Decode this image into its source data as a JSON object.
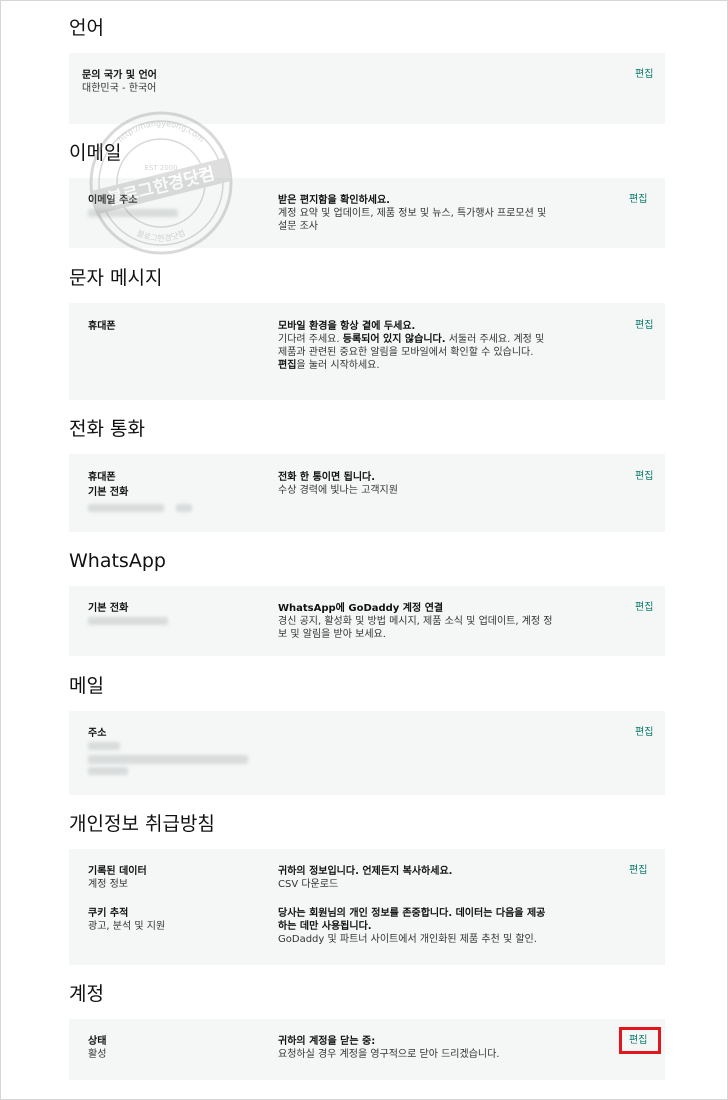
{
  "sections": {
    "language": {
      "title": "언어",
      "label": "문의 국가 및 언어",
      "value": "대한민국 - 한국어",
      "edit": "편집"
    },
    "email": {
      "title": "이메일",
      "label": "이메일 주소",
      "desc_bold": "받은 편지함을 확인하세요.",
      "desc": "계정 요약 및 업데이트, 제품 정보 및 뉴스, 특가행사 프로모션 및 설문 조사",
      "edit": "편집"
    },
    "sms": {
      "title": "문자 메시지",
      "label": "휴대폰",
      "desc_bold": "모바일 환경을 항상 곁에 두세요.",
      "desc_1": "기다려 주세요.",
      "desc_1_bold": "등록되어 있지 않습니다.",
      "desc_2": "서둘러 주세요. 계정 및 제품과 관련된 중요한 알림을 모바일에서 확인할 수 있습니다.",
      "desc_3_bold": "편집",
      "desc_3": "을 눌러 시작하세요.",
      "edit": "편집"
    },
    "phone": {
      "title": "전화 통화",
      "label_1": "휴대폰",
      "label_2": "기본 전화",
      "desc_bold": "전화 한 통이면 됩니다.",
      "desc": "수상 경력에 빛나는 고객지원",
      "edit": "편집"
    },
    "whatsapp": {
      "title": "WhatsApp",
      "label": "기본 전화",
      "desc_bold": "WhatsApp에 GoDaddy 계정 연결",
      "desc": "경신 공지, 활성화 및 방법 메시지, 제품 소식 및 업데이트, 계정 정보 및 알림을 받아 보세요.",
      "edit": "편집"
    },
    "mail": {
      "title": "메일",
      "label": "주소",
      "edit": "편집"
    },
    "privacy": {
      "title": "개인정보 취급방침",
      "row1_label": "기록된 데이터",
      "row1_value": "계정 정보",
      "row1_desc_bold": "귀하의 정보입니다. 언제든지 복사하세요.",
      "row1_desc": "CSV 다운로드",
      "row2_label": "쿠키 추적",
      "row2_value": "광고, 분석 및 지원",
      "row2_desc_bold": "당사는 회원님의 개인 정보를 존중합니다. 데이터는 다음을 제공하는 데만 사용됩니다.",
      "row2_desc": "GoDaddy 및 파트너 사이트에서 개인화된 제품 추천 및 할인.",
      "edit": "편집"
    },
    "account": {
      "title": "계정",
      "label": "상태",
      "value": "활성",
      "desc_bold": "귀하의 계정을 닫는 중:",
      "desc": "요청하실 경우 계정을 영구적으로 닫아 드리겠습니다.",
      "edit": "편집"
    }
  },
  "watermark": {
    "main": "블로그한경닷컴",
    "url": "http://hangyeong.com",
    "est": "EST 2000"
  },
  "colors": {
    "edit_link": "#0a7a6a",
    "card_bg": "#f5f7f7",
    "highlight": "#e1171e"
  }
}
